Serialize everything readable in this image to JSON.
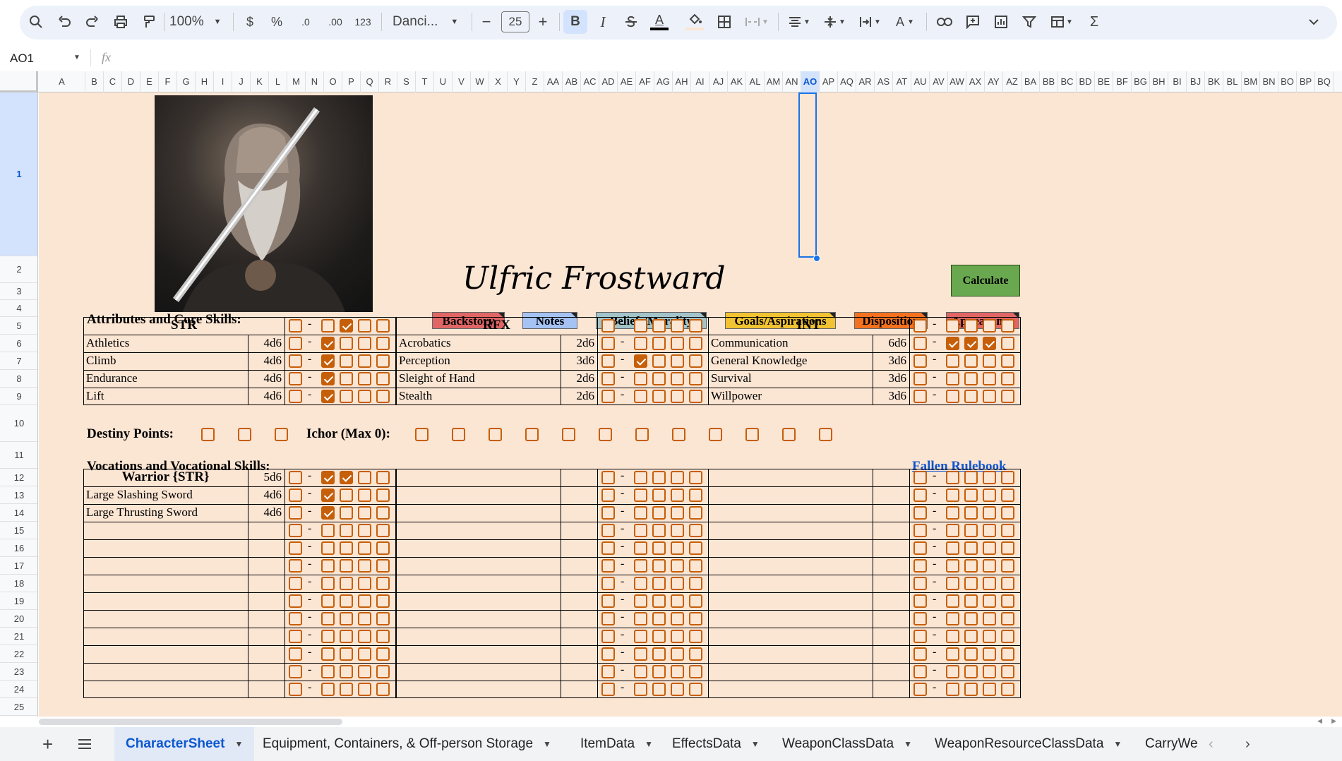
{
  "toolbar": {
    "zoom": "100%",
    "currency": "$",
    "percent": "%",
    "decrease_decimal": ".0",
    "increase_decimal": ".00",
    "number_format": "123",
    "font": "Danci...",
    "font_size": "25",
    "bold": "B",
    "italic": "I",
    "sigma": "Σ"
  },
  "formula_bar": {
    "name_box": "AO1",
    "fx": "fx",
    "value": ""
  },
  "columns": [
    "A",
    "B",
    "C",
    "D",
    "E",
    "F",
    "G",
    "H",
    "I",
    "J",
    "K",
    "L",
    "M",
    "N",
    "O",
    "P",
    "Q",
    "R",
    "S",
    "T",
    "U",
    "V",
    "W",
    "X",
    "Y",
    "Z",
    "AA",
    "AB",
    "AC",
    "AD",
    "AE",
    "AF",
    "AG",
    "AH",
    "AI",
    "AJ",
    "AK",
    "AL",
    "AM",
    "AN",
    "AO",
    "AP",
    "AQ",
    "AR",
    "AS",
    "AT",
    "AU",
    "AV",
    "AW",
    "AX",
    "AY",
    "AZ",
    "BA",
    "BB",
    "BC",
    "BD",
    "BE",
    "BF",
    "BG",
    "BH",
    "BI",
    "BJ",
    "BK",
    "BL",
    "BM",
    "BN",
    "BO",
    "BP",
    "BQ"
  ],
  "selected_column": "AO",
  "rows": [
    "1",
    "2",
    "3",
    "4",
    "5",
    "6",
    "7",
    "8",
    "9",
    "10",
    "11",
    "12",
    "13",
    "14",
    "15",
    "16",
    "17",
    "18",
    "19",
    "20",
    "21",
    "22",
    "23",
    "24",
    "25"
  ],
  "sheet": {
    "character_name": "Ulfric Frostward",
    "calculate_button": "Calculate",
    "section_attributes": "Attributes and Core Skills:",
    "tabs": [
      {
        "label": "Backstory",
        "color": "#e06666"
      },
      {
        "label": "Notes",
        "color": "#a4c2f4"
      },
      {
        "label": "Beliefs/Morality",
        "color": "#a2c4c9"
      },
      {
        "label": "Goals/Aspirations",
        "color": "#f1c232"
      },
      {
        "label": "Disposition",
        "color": "#f6711e"
      },
      {
        "label": "Appearance",
        "color": "#e06666"
      }
    ],
    "dash": "-",
    "attributes": [
      {
        "name": "STR",
        "checks": [
          false,
          true,
          false,
          false
        ],
        "skills": [
          {
            "name": "Athletics",
            "dice": "4d6",
            "first": false,
            "checks": [
              true,
              false,
              false,
              false
            ]
          },
          {
            "name": "Climb",
            "dice": "4d6",
            "first": false,
            "checks": [
              true,
              false,
              false,
              false
            ]
          },
          {
            "name": "Endurance",
            "dice": "4d6",
            "first": false,
            "checks": [
              true,
              false,
              false,
              false
            ]
          },
          {
            "name": "Lift",
            "dice": "4d6",
            "first": false,
            "checks": [
              true,
              false,
              false,
              false
            ]
          }
        ]
      },
      {
        "name": "RFX",
        "checks": [
          false,
          false,
          false,
          false
        ],
        "skills": [
          {
            "name": "Acrobatics",
            "dice": "2d6",
            "first": false,
            "checks": [
              false,
              false,
              false,
              false
            ]
          },
          {
            "name": "Perception",
            "dice": "3d6",
            "first": false,
            "checks": [
              true,
              false,
              false,
              false
            ]
          },
          {
            "name": "Sleight of Hand",
            "dice": "2d6",
            "first": false,
            "checks": [
              false,
              false,
              false,
              false
            ]
          },
          {
            "name": "Stealth",
            "dice": "2d6",
            "first": false,
            "checks": [
              false,
              false,
              false,
              false
            ]
          }
        ]
      },
      {
        "name": "INT",
        "checks": [
          false,
          false,
          false,
          false
        ],
        "skills": [
          {
            "name": "Communication",
            "dice": "6d6",
            "first": false,
            "checks": [
              true,
              true,
              true,
              false
            ]
          },
          {
            "name": "General Knowledge",
            "dice": "3d6",
            "first": false,
            "checks": [
              false,
              false,
              false,
              false
            ]
          },
          {
            "name": "Survival",
            "dice": "3d6",
            "first": false,
            "checks": [
              false,
              false,
              false,
              false
            ]
          },
          {
            "name": "Willpower",
            "dice": "3d6",
            "first": false,
            "checks": [
              false,
              false,
              false,
              false
            ]
          }
        ]
      }
    ],
    "destiny_label": "Destiny Points:",
    "destiny_points": [
      false,
      false,
      false
    ],
    "ichor_label": "Ichor (Max 0):",
    "ichor": [
      false,
      false,
      false,
      false,
      false,
      false,
      false,
      false,
      false,
      false,
      false,
      false
    ],
    "section_vocations": "Vocations and Vocational Skills:",
    "rulebook_link": "Fallen Rulebook",
    "vocation": {
      "name": "Warrior {STR}",
      "dice": "5d6",
      "checks": [
        true,
        true,
        false,
        false
      ],
      "skills": [
        {
          "name": "Large Slashing Sword",
          "dice": "4d6",
          "checks": [
            true,
            false,
            false,
            false
          ]
        },
        {
          "name": "Large Thrusting Sword",
          "dice": "4d6",
          "checks": [
            true,
            false,
            false,
            false
          ]
        }
      ]
    }
  },
  "sheet_tabs": [
    {
      "label": "CharacterSheet",
      "active": true
    },
    {
      "label": "Equipment, Containers, & Off-person Storage",
      "active": false
    },
    {
      "label": "ItemData",
      "active": false
    },
    {
      "label": "EffectsData",
      "active": false
    },
    {
      "label": "WeaponClassData",
      "active": false
    },
    {
      "label": "WeaponResourceClassData",
      "active": false
    },
    {
      "label": "CarryWe",
      "active": false
    }
  ],
  "colors": {
    "sheet_bg": "#fbe5d3",
    "checkbox": "#c65f0a",
    "calculate": "#6aa84f",
    "link": "#1155cc",
    "selection": "#1a73e8"
  }
}
